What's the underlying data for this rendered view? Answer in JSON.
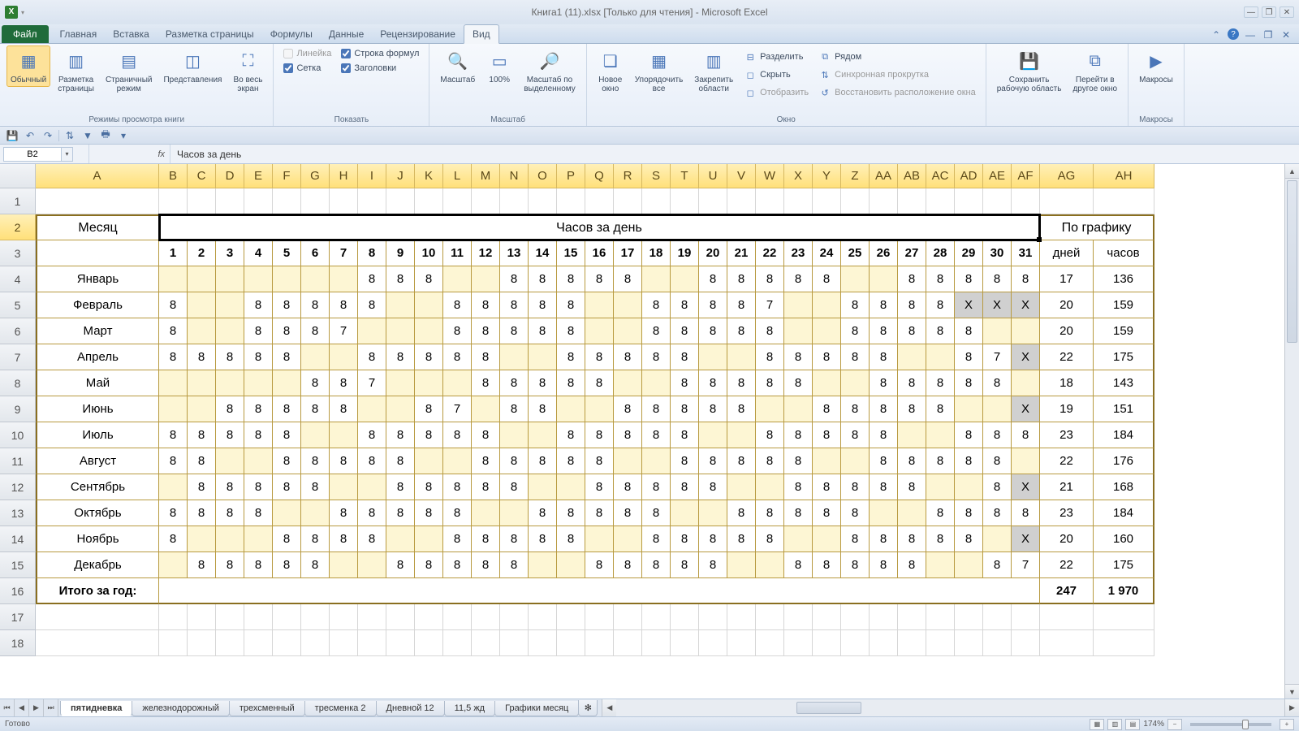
{
  "title": "Книга1 (11).xlsx  [Только для чтения] - Microsoft Excel",
  "tabs": {
    "file": "Файл",
    "items": [
      "Главная",
      "Вставка",
      "Разметка страницы",
      "Формулы",
      "Данные",
      "Рецензирование",
      "Вид"
    ],
    "active_index": 6
  },
  "ribbon": {
    "group1": {
      "label": "Режимы просмотра книги",
      "btn_normal": "Обычный",
      "btn_layout": "Разметка\nстраницы",
      "btn_pagebreak": "Страничный\nрежим",
      "btn_custom": "Представления",
      "btn_fullscreen": "Во весь\nэкран"
    },
    "group2": {
      "label": "Показать",
      "chk_ruler": "Линейка",
      "chk_formula": "Строка формул",
      "chk_grid": "Сетка",
      "chk_headings": "Заголовки"
    },
    "group3": {
      "label": "Масштаб",
      "btn_zoom": "Масштаб",
      "btn_100": "100%",
      "btn_zoomsel": "Масштаб по\nвыделенному"
    },
    "group4": {
      "label": "Окно",
      "btn_neww": "Новое\nокно",
      "btn_arrange": "Упорядочить\nвсе",
      "btn_freeze": "Закрепить\nобласти",
      "small_split": "Разделить",
      "small_hide": "Скрыть",
      "small_unhide": "Отобразить",
      "small_side": "Рядом",
      "small_sync": "Синхронная прокрутка",
      "small_reset": "Восстановить расположение окна"
    },
    "group5": {
      "btn_save": "Сохранить\nрабочую область",
      "btn_switch": "Перейти в\nдругое окно"
    },
    "group6": {
      "label": "Макросы",
      "btn_macros": "Макросы"
    }
  },
  "namebox": "B2",
  "formula": "Часов за день",
  "columns": [
    "A",
    "B",
    "C",
    "D",
    "E",
    "F",
    "G",
    "H",
    "I",
    "J",
    "K",
    "L",
    "M",
    "N",
    "O",
    "P",
    "Q",
    "R",
    "S",
    "T",
    "U",
    "V",
    "W",
    "X",
    "Y",
    "Z",
    "AA",
    "AB",
    "AC",
    "AD",
    "AE",
    "AF",
    "AG",
    "AH"
  ],
  "col_widths": {
    "A": 152,
    "day": 35,
    "AG": 66,
    "AH": 75
  },
  "header_month": "Месяц",
  "header_hours": "Часов за день",
  "header_graph": "По графику",
  "header_days": "дней",
  "header_hrs": "часов",
  "day_numbers": [
    "1",
    "2",
    "3",
    "4",
    "5",
    "6",
    "7",
    "8",
    "9",
    "10",
    "11",
    "12",
    "13",
    "14",
    "15",
    "16",
    "17",
    "18",
    "19",
    "20",
    "21",
    "22",
    "23",
    "24",
    "25",
    "26",
    "27",
    "28",
    "29",
    "30",
    "31"
  ],
  "months": [
    "Январь",
    "Февраль",
    "Март",
    "Апрель",
    "Май",
    "Июнь",
    "Июль",
    "Август",
    "Сентябрь",
    "Октябрь",
    "Ноябрь",
    "Декабрь"
  ],
  "totals_label": "Итого за год:",
  "totals_days": "247",
  "totals_hours": "1 970",
  "rows": [
    {
      "month": 0,
      "cells": [
        "",
        "",
        "",
        "",
        "",
        "",
        "",
        "8",
        "8",
        "8",
        "",
        "",
        "8",
        "8",
        "8",
        "8",
        "8",
        "",
        "",
        "8",
        "8",
        "8",
        "8",
        "8",
        "",
        "",
        "8",
        "8",
        "8",
        "8",
        "8"
      ],
      "yellow": [
        1,
        2,
        3,
        4,
        5,
        6,
        7,
        11,
        12,
        18,
        19,
        25,
        26
      ],
      "days": "17",
      "hours": "136"
    },
    {
      "month": 1,
      "cells": [
        "8",
        "",
        "",
        "8",
        "8",
        "8",
        "8",
        "8",
        "",
        "",
        "8",
        "8",
        "8",
        "8",
        "8",
        "",
        "",
        "8",
        "8",
        "8",
        "8",
        "7",
        "",
        "",
        "8",
        "8",
        "8",
        "8",
        "X",
        "X",
        "X"
      ],
      "yellow": [
        2,
        3,
        9,
        10,
        16,
        17,
        23,
        24
      ],
      "gray": [
        29,
        30,
        31
      ],
      "days": "20",
      "hours": "159"
    },
    {
      "month": 2,
      "cells": [
        "8",
        "",
        "",
        "8",
        "8",
        "8",
        "7",
        "",
        "",
        "",
        "8",
        "8",
        "8",
        "8",
        "8",
        "",
        "",
        "8",
        "8",
        "8",
        "8",
        "8",
        "",
        "",
        "8",
        "8",
        "8",
        "8",
        "8",
        "",
        ""
      ],
      "yellow": [
        2,
        3,
        8,
        9,
        10,
        16,
        17,
        23,
        24,
        30,
        31
      ],
      "days": "20",
      "hours": "159"
    },
    {
      "month": 3,
      "cells": [
        "8",
        "8",
        "8",
        "8",
        "8",
        "",
        "",
        "8",
        "8",
        "8",
        "8",
        "8",
        "",
        "",
        "8",
        "8",
        "8",
        "8",
        "8",
        "",
        "",
        "8",
        "8",
        "8",
        "8",
        "8",
        "",
        "",
        "8",
        "7",
        "X"
      ],
      "yellow": [
        6,
        7,
        13,
        14,
        20,
        21,
        27,
        28
      ],
      "gray": [
        31
      ],
      "days": "22",
      "hours": "175"
    },
    {
      "month": 4,
      "cells": [
        "",
        "",
        "",
        "",
        "",
        "8",
        "8",
        "7",
        "",
        "",
        "",
        "8",
        "8",
        "8",
        "8",
        "8",
        "",
        "",
        "8",
        "8",
        "8",
        "8",
        "8",
        "",
        "",
        "8",
        "8",
        "8",
        "8",
        "8",
        ""
      ],
      "yellow": [
        1,
        2,
        3,
        4,
        5,
        9,
        10,
        11,
        17,
        18,
        24,
        25,
        31
      ],
      "days": "18",
      "hours": "143"
    },
    {
      "month": 5,
      "cells": [
        "",
        "",
        "8",
        "8",
        "8",
        "8",
        "8",
        "",
        "",
        "8",
        "7",
        "",
        "8",
        "8",
        "",
        "",
        "8",
        "8",
        "8",
        "8",
        "8",
        "",
        "",
        "8",
        "8",
        "8",
        "8",
        "8",
        "",
        "",
        "X"
      ],
      "yellow": [
        1,
        2,
        8,
        9,
        12,
        15,
        16,
        22,
        23,
        29,
        30
      ],
      "gray": [
        31
      ],
      "days": "19",
      "hours": "151"
    },
    {
      "month": 6,
      "cells": [
        "8",
        "8",
        "8",
        "8",
        "8",
        "",
        "",
        "8",
        "8",
        "8",
        "8",
        "8",
        "",
        "",
        "8",
        "8",
        "8",
        "8",
        "8",
        "",
        "",
        "8",
        "8",
        "8",
        "8",
        "8",
        "",
        "",
        "8",
        "8",
        "8"
      ],
      "yellow": [
        6,
        7,
        13,
        14,
        20,
        21,
        27,
        28
      ],
      "days": "23",
      "hours": "184"
    },
    {
      "month": 7,
      "cells": [
        "8",
        "8",
        "",
        "",
        "8",
        "8",
        "8",
        "8",
        "8",
        "",
        "",
        "8",
        "8",
        "8",
        "8",
        "8",
        "",
        "",
        "8",
        "8",
        "8",
        "8",
        "8",
        "",
        "",
        "8",
        "8",
        "8",
        "8",
        "8",
        ""
      ],
      "yellow": [
        3,
        4,
        10,
        11,
        17,
        18,
        24,
        25,
        31
      ],
      "days": "22",
      "hours": "176"
    },
    {
      "month": 8,
      "cells": [
        "",
        "8",
        "8",
        "8",
        "8",
        "8",
        "",
        "",
        "8",
        "8",
        "8",
        "8",
        "8",
        "",
        "",
        "8",
        "8",
        "8",
        "8",
        "8",
        "",
        "",
        "8",
        "8",
        "8",
        "8",
        "8",
        "",
        "",
        "8",
        "X"
      ],
      "yellow": [
        1,
        7,
        8,
        14,
        15,
        21,
        22,
        28,
        29
      ],
      "gray": [
        31
      ],
      "days": "21",
      "hours": "168"
    },
    {
      "month": 9,
      "cells": [
        "8",
        "8",
        "8",
        "8",
        "",
        "",
        "8",
        "8",
        "8",
        "8",
        "8",
        "",
        "",
        "8",
        "8",
        "8",
        "8",
        "8",
        "",
        "",
        "8",
        "8",
        "8",
        "8",
        "8",
        "",
        "",
        "8",
        "8",
        "8",
        "8"
      ],
      "yellow": [
        5,
        6,
        12,
        13,
        19,
        20,
        26,
        27
      ],
      "days": "23",
      "hours": "184"
    },
    {
      "month": 10,
      "cells": [
        "8",
        "",
        "",
        "",
        "8",
        "8",
        "8",
        "8",
        "",
        "",
        "8",
        "8",
        "8",
        "8",
        "8",
        "",
        "",
        "8",
        "8",
        "8",
        "8",
        "8",
        "",
        "",
        "8",
        "8",
        "8",
        "8",
        "8",
        "",
        "X"
      ],
      "yellow": [
        2,
        3,
        4,
        9,
        10,
        16,
        17,
        23,
        24,
        30
      ],
      "gray": [
        31
      ],
      "days": "20",
      "hours": "160"
    },
    {
      "month": 11,
      "cells": [
        "",
        "8",
        "8",
        "8",
        "8",
        "8",
        "",
        "",
        "8",
        "8",
        "8",
        "8",
        "8",
        "",
        "",
        "8",
        "8",
        "8",
        "8",
        "8",
        "",
        "",
        "8",
        "8",
        "8",
        "8",
        "8",
        "",
        "",
        "8",
        "7"
      ],
      "yellow": [
        1,
        7,
        8,
        14,
        15,
        21,
        22,
        28,
        29
      ],
      "days": "22",
      "hours": "175"
    }
  ],
  "sheet_tabs": [
    "пятидневка",
    "железнодорожный",
    "трехсменный",
    "тресменка 2",
    "Дневной 12",
    "11,5 жд",
    "Графики месяц"
  ],
  "sheet_active": 0,
  "status": "Готово",
  "zoom": "174%"
}
